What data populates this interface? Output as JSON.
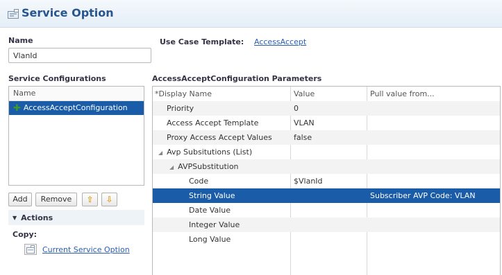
{
  "header": {
    "title": "Service Option",
    "icon": "service-option-icon"
  },
  "name_section": {
    "label": "Name",
    "value": "VlanId"
  },
  "use_case": {
    "label": "Use Case Template:",
    "link": "AccessAccept"
  },
  "service_configs": {
    "label": "Service Configurations",
    "column_header": "Name",
    "items": [
      "AccessAcceptConfiguration"
    ],
    "selected_index": 0
  },
  "buttons": {
    "add": "Add",
    "remove": "Remove",
    "up_icon": "arrow-up-icon",
    "down_icon": "arrow-down-icon"
  },
  "actions": {
    "title": "Actions",
    "copy_label": "Copy:",
    "copy_link": "Current Service Option"
  },
  "params": {
    "title": "AccessAcceptConfiguration Parameters",
    "columns": [
      "*Display Name",
      "Value",
      "Pull value from..."
    ],
    "rows": [
      {
        "name": "Priority",
        "value": "0",
        "pull": "",
        "level": 0,
        "expander": false
      },
      {
        "name": "Access Accept Template",
        "value": "VLAN",
        "pull": "",
        "level": 0,
        "expander": false
      },
      {
        "name": "Proxy Access Accept Values",
        "value": "false",
        "pull": "",
        "level": 0,
        "expander": false
      },
      {
        "name": "Avp Subsitutions (List)",
        "value": "",
        "pull": "",
        "level": 0,
        "expander": true
      },
      {
        "name": "AVPSubstitution",
        "value": "",
        "pull": "",
        "level": 1,
        "expander": true
      },
      {
        "name": "Code",
        "value": "$VlanId",
        "pull": "",
        "level": 2,
        "expander": false
      },
      {
        "name": "String Value",
        "value": "",
        "pull": "Subscriber AVP Code: VLAN",
        "level": 2,
        "expander": false
      },
      {
        "name": "Date Value",
        "value": "",
        "pull": "",
        "level": 2,
        "expander": false
      },
      {
        "name": "Integer Value",
        "value": "",
        "pull": "",
        "level": 2,
        "expander": false
      },
      {
        "name": "Long Value",
        "value": "",
        "pull": "",
        "level": 2,
        "expander": false
      }
    ],
    "selected_row": 6
  },
  "colors": {
    "accent": "#27558f",
    "selection": "#1a5ca8",
    "link": "#2a5db0"
  }
}
